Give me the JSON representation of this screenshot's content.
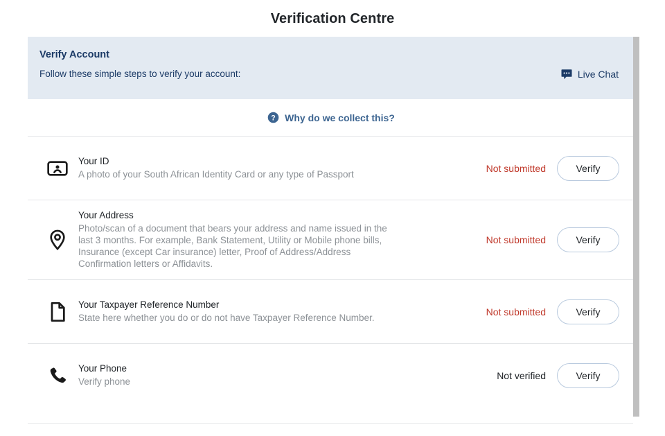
{
  "page": {
    "title": "Verification Centre"
  },
  "banner": {
    "title": "Verify Account",
    "subtitle": "Follow these simple steps to verify your account:",
    "live_chat_label": "Live Chat",
    "live_chat_icon": "chat-bubble-icon",
    "background_color": "#e3eaf2",
    "text_color": "#1b3a66"
  },
  "why_collect": {
    "label": "Why do we collect this?",
    "icon": "question-circle-icon",
    "color": "#3d6591"
  },
  "items": [
    {
      "icon": "id-card-icon",
      "title": "Your ID",
      "description": "A photo of your South African Identity Card or any type of Passport",
      "status": "Not submitted",
      "status_type": "danger",
      "button_label": "Verify"
    },
    {
      "icon": "location-pin-icon",
      "title": "Your Address",
      "description": "Photo/scan of a document that bears your address and name issued in the last 3 months. For example, Bank Statement, Utility or Mobile phone bills, Insurance (except Car insurance) letter, Proof of Address/Address Confirmation letters or Affidavits.",
      "status": "Not submitted",
      "status_type": "danger",
      "button_label": "Verify"
    },
    {
      "icon": "document-icon",
      "title": "Your Taxpayer Reference Number",
      "description": "State here whether you do or do not have Taxpayer Reference Number.",
      "status": "Not submitted",
      "status_type": "danger",
      "button_label": "Verify"
    },
    {
      "icon": "phone-icon",
      "title": "Your Phone",
      "description": "Verify phone",
      "status": "Not verified",
      "status_type": "neutral",
      "button_label": "Verify"
    }
  ],
  "colors": {
    "danger": "#c0392b",
    "accent": "#1b3a66",
    "link": "#3d6591",
    "border": "#e4e6e8",
    "button_border": "#b9cade"
  }
}
